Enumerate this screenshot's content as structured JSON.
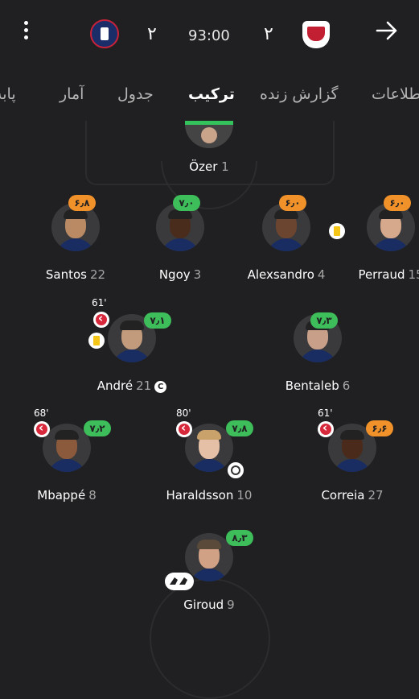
{
  "header": {
    "home_team": "PSG",
    "away_team": "Lille",
    "home_score": "۲",
    "away_score": "۲",
    "clock": "93:00"
  },
  "tabs": [
    {
      "label": "اطلاعات",
      "active": false
    },
    {
      "label": "گزارش زنده",
      "active": false
    },
    {
      "label": "ترکیب",
      "active": true
    },
    {
      "label": "جدول",
      "active": false
    },
    {
      "label": "آمار",
      "active": false
    },
    {
      "label": "پابه‌پا",
      "active": false
    }
  ],
  "goalkeeper": {
    "name": "Özer",
    "number": "1"
  },
  "players": {
    "santos": {
      "name": "Santos",
      "number": "22",
      "rating": "۶٫۸",
      "rating_color": "#f0912a"
    },
    "ngoy": {
      "name": "Ngoy",
      "number": "3",
      "rating": "۷٫۰",
      "rating_color": "#3ebd5b"
    },
    "alexsandro": {
      "name": "Alexsandro",
      "number": "4",
      "rating": "۶٫۰",
      "rating_color": "#f0912a"
    },
    "perraud": {
      "name": "Perraud",
      "number": "15",
      "rating": "۶٫۰",
      "rating_color": "#f0912a"
    },
    "andre": {
      "name": "André",
      "number": "21",
      "rating": "۷٫۱",
      "rating_color": "#3ebd5b",
      "sub_time": "61'",
      "captain": "C"
    },
    "bentaleb": {
      "name": "Bentaleb",
      "number": "6",
      "rating": "۷٫۳",
      "rating_color": "#3ebd5b"
    },
    "mbappe": {
      "name": "Mbappé",
      "number": "8",
      "rating": "۷٫۲",
      "rating_color": "#3ebd5b",
      "sub_time": "68'"
    },
    "haraldsson": {
      "name": "Haraldsson",
      "number": "10",
      "rating": "۷٫۸",
      "rating_color": "#3ebd5b",
      "sub_time": "80'"
    },
    "correia": {
      "name": "Correia",
      "number": "27",
      "rating": "۶٫۶",
      "rating_color": "#f0912a",
      "sub_time": "61'"
    },
    "giroud": {
      "name": "Giroud",
      "number": "9",
      "rating": "۸٫۳",
      "rating_color": "#3ebd5b"
    }
  },
  "colors": {
    "background": "#202022",
    "rating_green": "#3ebd5b",
    "rating_orange": "#f0912a",
    "sub_red": "#d8283b",
    "card_yellow": "#f5c518"
  }
}
